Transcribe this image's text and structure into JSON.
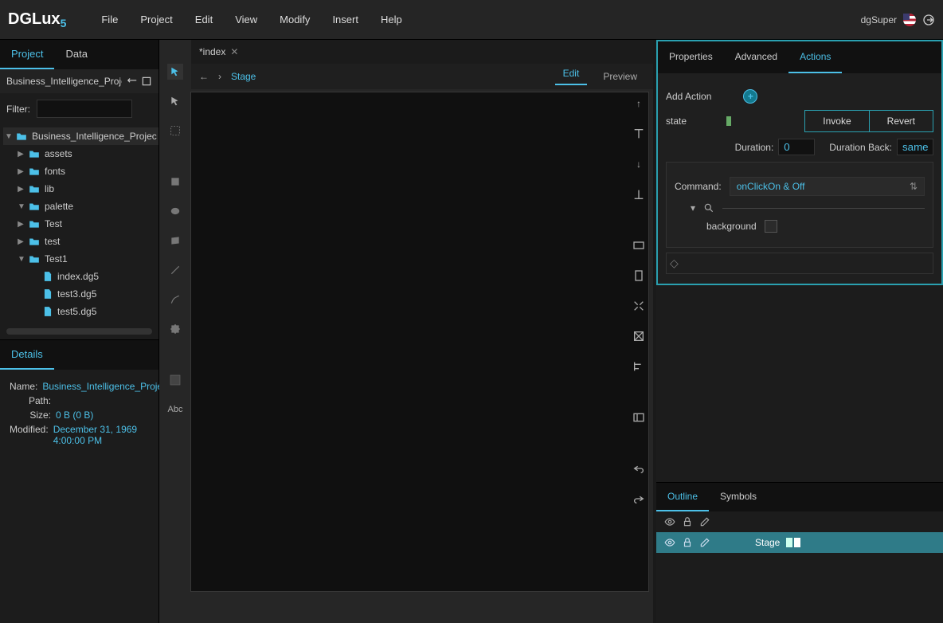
{
  "menu": {
    "items": [
      "File",
      "Project",
      "Edit",
      "View",
      "Modify",
      "Insert",
      "Help"
    ],
    "user": "dgSuper"
  },
  "logo": {
    "brand": "DGLux",
    "suffix": "5"
  },
  "leftTabs": {
    "project": "Project",
    "data": "Data"
  },
  "breadcrumb": "Business_Intelligence_Project",
  "filter": {
    "label": "Filter:",
    "value": ""
  },
  "tree": {
    "root": "Business_Intelligence_Projec",
    "folders": [
      "assets",
      "fonts",
      "lib",
      "palette",
      "Test",
      "test",
      "Test1"
    ],
    "files": [
      "index.dg5",
      "test3.dg5",
      "test5.dg5"
    ]
  },
  "details": {
    "tab": "Details",
    "name_label": "Name:",
    "name": "Business_Intelligence_Proje",
    "path_label": "Path:",
    "path": "",
    "size_label": "Size:",
    "size": "0 B (0 B)",
    "modified_label": "Modified:",
    "modified": "December 31, 1969 4:00:00 PM"
  },
  "doc": {
    "tab": "*index"
  },
  "stage": {
    "label": "Stage",
    "edit": "Edit",
    "preview": "Preview"
  },
  "toolCol": {
    "abc": "Abc"
  },
  "propTabs": {
    "p": "Properties",
    "a": "Advanced",
    "ac": "Actions"
  },
  "actions": {
    "add_action": "Add Action",
    "state": "state",
    "invoke": "Invoke",
    "revert": "Revert",
    "duration_label": "Duration:",
    "duration": "0",
    "duration_back_label": "Duration Back:",
    "duration_back": "same",
    "command_label": "Command:",
    "command": "onClickOn & Off",
    "background": "background"
  },
  "outlineTabs": {
    "o": "Outline",
    "s": "Symbols"
  },
  "outline": {
    "stage": "Stage"
  }
}
